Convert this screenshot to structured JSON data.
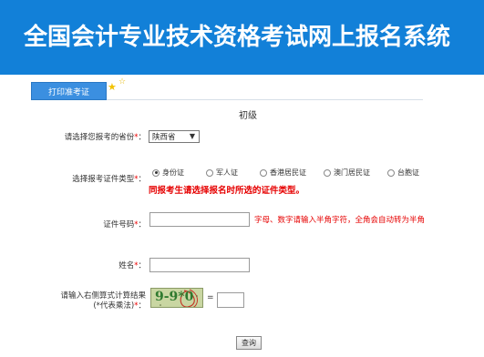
{
  "header": {
    "title": "全国会计专业技术资格考试网上报名系统"
  },
  "tab": {
    "label": "打印准考证"
  },
  "level": "初级",
  "province": {
    "label": "请选择您报考的省份",
    "selected": "陕西省"
  },
  "cert_type": {
    "label": "选择报考证件类型",
    "options": [
      "身份证",
      "军人证",
      "香港居民证",
      "澳门居民证",
      "台胞证"
    ],
    "selected_index": 0,
    "warning": "同报考生请选择报名时所选的证件类型。"
  },
  "id_number": {
    "label": "证件号码",
    "value": "",
    "hint": "字母、数字请输入半角字符，全角会自动转为半角"
  },
  "name_field": {
    "label": "姓名",
    "value": ""
  },
  "captcha": {
    "label_line1": "请输入右侧算式计算结果",
    "label_line2": "(*代表乘法)",
    "expression": "9-9*0",
    "equals": "=",
    "answer": ""
  },
  "required_mark": "*",
  "colon": "：",
  "query_button": "查询"
}
